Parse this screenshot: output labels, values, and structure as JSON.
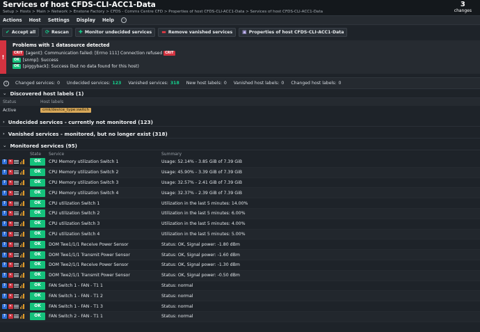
{
  "header": {
    "title": "Services of host CFDS-CLI-ACC1-Data",
    "breadcrumb": "Setup > Hosts > Main > Network > Enstone Factory > CFDS - Comms Centre CFD > Properties of host CFDS-CLI-ACC1-Data > Services of host CFDS-CLI-ACC1-Data",
    "changes_count": "3",
    "changes_label": "changes"
  },
  "menu": {
    "items": [
      "Actions",
      "Host",
      "Settings",
      "Display",
      "Help"
    ],
    "more_glyph": "···"
  },
  "toolbar": {
    "accept_all": "Accept all",
    "rescan": "Rescan",
    "monitor_undecided": "Monitor undecided services",
    "remove_vanished": "Remove vanished services",
    "properties": "Properties of host CFDS-CLI-ACC1-Data"
  },
  "problems": {
    "title": "Problems with 1 datasource detected",
    "stripe_glyph": "!",
    "lines": [
      {
        "badge": "CRIT",
        "text": "[agent]: Communication failed: [Errno 111] Connection refused",
        "trail_badge": "CRIT"
      },
      {
        "badge": "OK",
        "text": "[snmp]: Success"
      },
      {
        "badge": "OK",
        "text": "[piggyback]: Success (but no data found for this host)"
      }
    ]
  },
  "summary": {
    "info_glyph": "i",
    "items": [
      {
        "label": "Changed services:",
        "value": "0"
      },
      {
        "label": "Undecided services:",
        "value": "123",
        "highlight": true
      },
      {
        "label": "Vanished services:",
        "value": "318",
        "highlight": true
      },
      {
        "label": "New host labels:",
        "value": "0"
      },
      {
        "label": "Vanished host labels:",
        "value": "0"
      },
      {
        "label": "Changed host labels:",
        "value": "0"
      }
    ]
  },
  "sections": {
    "discovered_labels": "Discovered host labels (1)",
    "undecided": "Undecided services - currently not monitored (123)",
    "vanished": "Vanished services - monitored, but no longer exist (318)",
    "monitored": "Monitored services (95)"
  },
  "host_labels": {
    "col_status": "Status",
    "col_labels": "Host labels",
    "row_status": "Active",
    "row_label": "cmk/device_type:switch"
  },
  "services": {
    "col_state": "State",
    "col_service": "Service",
    "col_summary": "Summary",
    "rows": [
      {
        "state": "OK",
        "service": "CPU Memory utilization Switch 1",
        "summary": "Usage: 52.14% - 3.85 GiB of 7.39 GiB"
      },
      {
        "state": "OK",
        "service": "CPU Memory utilization Switch 2",
        "summary": "Usage: 45.90% - 3.39 GiB of 7.39 GiB"
      },
      {
        "state": "OK",
        "service": "CPU Memory utilization Switch 3",
        "summary": "Usage: 32.57% - 2.41 GiB of 7.39 GiB"
      },
      {
        "state": "OK",
        "service": "CPU Memory utilization Switch 4",
        "summary": "Usage: 32.37% - 2.39 GiB of 7.39 GiB"
      },
      {
        "state": "OK",
        "service": "CPU utilization Switch 1",
        "summary": "Utilization in the last 5 minutes: 14.00%"
      },
      {
        "state": "OK",
        "service": "CPU utilization Switch 2",
        "summary": "Utilization in the last 5 minutes: 6.00%"
      },
      {
        "state": "OK",
        "service": "CPU utilization Switch 3",
        "summary": "Utilization in the last 5 minutes: 4.00%"
      },
      {
        "state": "OK",
        "service": "CPU utilization Switch 4",
        "summary": "Utilization in the last 5 minutes: 5.00%"
      },
      {
        "state": "OK",
        "service": "DOM Twe1/1/1 Receive Power Sensor",
        "summary": "Status: OK, Signal power: -1.80 dBm"
      },
      {
        "state": "OK",
        "service": "DOM Twe1/1/1 Transmit Power Sensor",
        "summary": "Status: OK, Signal power: -1.60 dBm"
      },
      {
        "state": "OK",
        "service": "DOM Twe2/1/1 Receive Power Sensor",
        "summary": "Status: OK, Signal power: -1.30 dBm"
      },
      {
        "state": "OK",
        "service": "DOM Twe2/1/1 Transmit Power Sensor",
        "summary": "Status: OK, Signal power: -0.50 dBm"
      },
      {
        "state": "OK",
        "service": "FAN Switch 1 - FAN - T1 1",
        "summary": "Status: normal"
      },
      {
        "state": "OK",
        "service": "FAN Switch 1 - FAN - T1 2",
        "summary": "Status: normal"
      },
      {
        "state": "OK",
        "service": "FAN Switch 1 - FAN - T1 3",
        "summary": "Status: normal"
      },
      {
        "state": "OK",
        "service": "FAN Switch 2 - FAN - T1 1",
        "summary": "Status: normal"
      }
    ]
  },
  "colors": {
    "ok": "#15c27c",
    "crit": "#d33340",
    "accent_green": "#13d38e",
    "background": "#1e2329"
  },
  "icons": {
    "accept_all": "check-circle-icon",
    "rescan": "refresh-icon",
    "monitor_undecided": "plus-icon",
    "remove_vanished": "minus-icon",
    "properties": "host-properties-icon",
    "row_help": "question-icon",
    "row_remove": "close-icon",
    "row_menu": "menu-icon",
    "row_graph": "perfometer-icon"
  }
}
